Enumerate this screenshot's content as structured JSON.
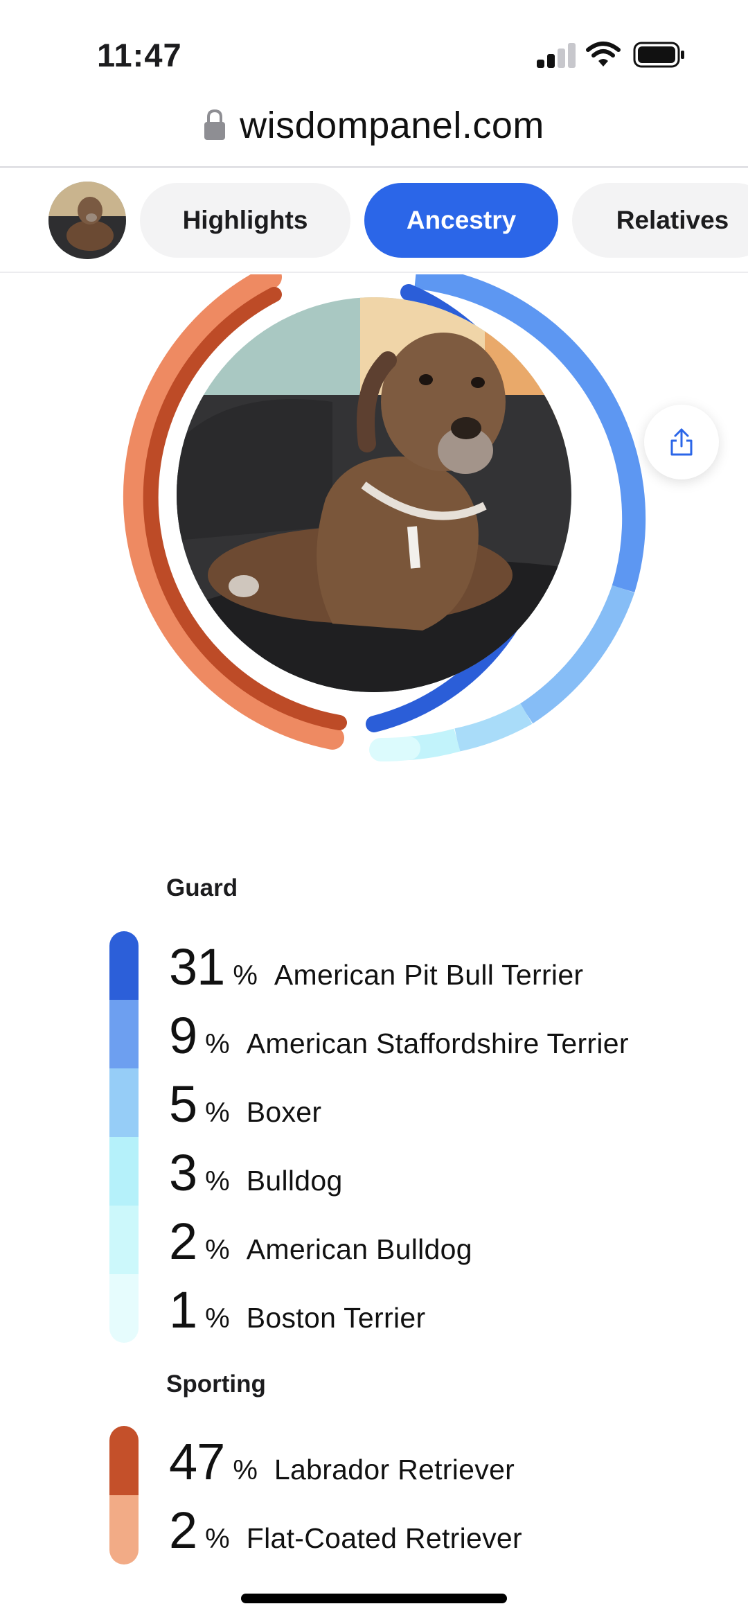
{
  "status_bar": {
    "time": "11:47",
    "signal_icon": "signal-bars-icon",
    "wifi_icon": "wifi-icon",
    "battery_icon": "battery-full-icon"
  },
  "browser": {
    "url": "wisdompanel.com",
    "lock_icon": "lock-icon"
  },
  "nav": {
    "avatar_icon": "dog-avatar",
    "tabs": [
      {
        "label": "Highlights",
        "active": false
      },
      {
        "label": "Ancestry",
        "active": true
      },
      {
        "label": "Relatives",
        "active": false
      }
    ]
  },
  "ancestry_ring": {
    "share_icon": "share-icon",
    "photo_icon": "dog-photo"
  },
  "groups": [
    {
      "title": "Guard",
      "breeds": [
        {
          "percent": "31",
          "sign": "%",
          "name": "American Pit Bull Terrier",
          "color": "#2c5fd9"
        },
        {
          "percent": "9",
          "sign": "%",
          "name": "American Staffordshire Terrier",
          "color": "#6d9ff0"
        },
        {
          "percent": "5",
          "sign": "%",
          "name": "Boxer",
          "color": "#96cdf7"
        },
        {
          "percent": "3",
          "sign": "%",
          "name": "Bulldog",
          "color": "#b5f1fa"
        },
        {
          "percent": "2",
          "sign": "%",
          "name": "American Bulldog",
          "color": "#ccf8fb"
        },
        {
          "percent": "1",
          "sign": "%",
          "name": "Boston Terrier",
          "color": "#e6fcfd"
        }
      ]
    },
    {
      "title": "Sporting",
      "breeds": [
        {
          "percent": "47",
          "sign": "%",
          "name": "Labrador Retriever",
          "color": "#c4502a"
        },
        {
          "percent": "2",
          "sign": "%",
          "name": "Flat-Coated Retriever",
          "color": "#f2ab86"
        }
      ]
    }
  ]
}
